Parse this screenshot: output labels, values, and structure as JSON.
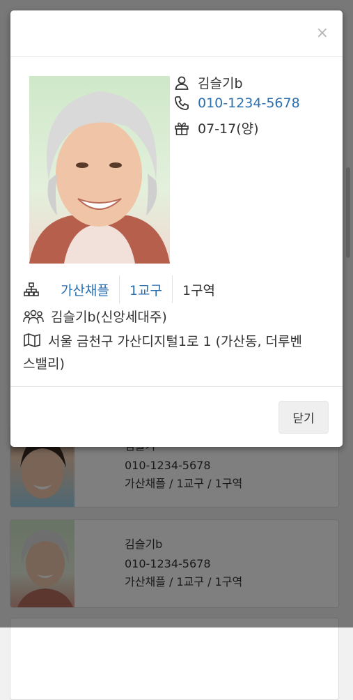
{
  "modal": {
    "close_symbol": "×",
    "name": "김슬기b",
    "phone": "010-1234-5678",
    "birthday": "07-17(양)",
    "church": "가산채플",
    "parish": "1교구",
    "district": "1구역",
    "family": "김슬기b(신앙세대주)",
    "address_line1": "서울 금천구 가산디지털1로 1 (가산동, 더루벤",
    "address_line2": "스밸리)",
    "close_button": "닫기"
  },
  "list": [
    {
      "name": "김슬기",
      "phone": "010-1234-5678",
      "org": "가산채플 / 1교구 / 1구역"
    },
    {
      "name": "김슬기b",
      "phone": "010-1234-5678",
      "org": "가산채플 / 1교구 / 1구역"
    }
  ],
  "colors": {
    "link": "#2a6fb0",
    "overlay": "rgba(0,0,0,0.5)"
  },
  "icons": [
    "user-icon",
    "phone-icon",
    "gift-icon",
    "sitemap-icon",
    "users-icon",
    "map-icon"
  ]
}
